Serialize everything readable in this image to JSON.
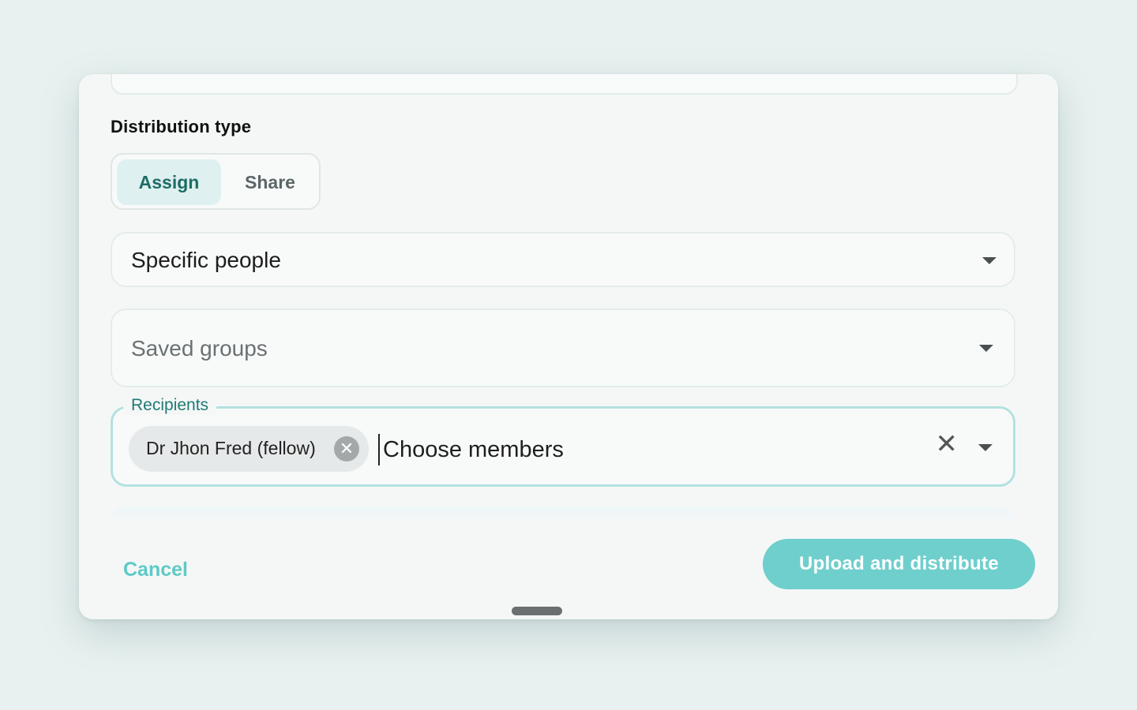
{
  "distribution": {
    "title": "Distribution type",
    "tabs": [
      {
        "label": "Assign",
        "active": true
      },
      {
        "label": "Share",
        "active": false
      }
    ]
  },
  "audience": {
    "selected": "Specific people"
  },
  "groups": {
    "placeholder": "Saved groups"
  },
  "recipients": {
    "label": "Recipients",
    "chips": [
      {
        "label": "Dr Jhon Fred (fellow)"
      }
    ],
    "input_placeholder": "Choose members"
  },
  "footer": {
    "cancel_label": "Cancel",
    "primary_label": "Upload and distribute"
  },
  "colors": {
    "accent": "#6fcfcc",
    "active_tab_bg": "#dff0f0",
    "active_tab_text": "#1e6c66",
    "recipients_border": "#b3e2df"
  },
  "icons": {
    "dropdown": "chevron-down-icon",
    "chip_remove": "close-circle-icon",
    "clear": "close-icon"
  }
}
